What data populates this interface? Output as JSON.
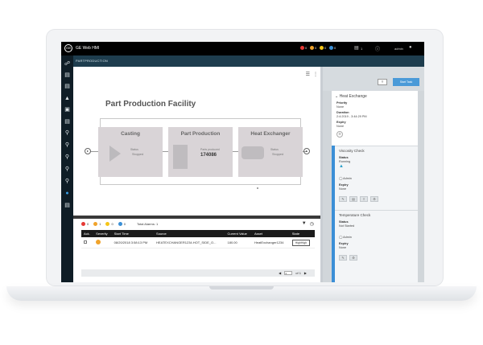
{
  "app": {
    "logo": "GE",
    "title": "GE Web HMI",
    "breadcrumb": "PARTPRODUCTION",
    "user": "admin",
    "alarm_counts": [
      {
        "count": "0",
        "color": "#e53935"
      },
      {
        "count": "0",
        "color": "#f0a32b"
      },
      {
        "count": "0",
        "color": "#f5c518"
      },
      {
        "count": "0",
        "color": "#3b8fd6"
      }
    ],
    "topbar_counter": "1"
  },
  "nav_icons": [
    "share-icon",
    "layers-icon",
    "layers-icon",
    "drop-icon",
    "image-icon",
    "layers-icon",
    "search-icon",
    "search-icon",
    "search-icon",
    "search-icon",
    "search-icon",
    "group-icon",
    "document-icon"
  ],
  "diagram": {
    "title": "Part Production Facility",
    "stages": [
      {
        "name": "Casting",
        "status_label": "Status",
        "status_value": "Stopped"
      },
      {
        "name": "Part Production",
        "parts_label": "Parts produced",
        "parts_value": "174086"
      },
      {
        "name": "Heat Exchanger",
        "status_label": "Status",
        "status_value": "Stopped"
      }
    ]
  },
  "alarms": {
    "severity_counts": [
      {
        "count": "0",
        "color": "#e53935"
      },
      {
        "count": "1",
        "color": "#f0a32b"
      },
      {
        "count": "0",
        "color": "#f5c518"
      },
      {
        "count": "0",
        "color": "#3b8fd6"
      }
    ],
    "total_label": "Total Alarms: 1",
    "columns": [
      "Ack.",
      "Severity",
      "Start Time",
      "Source",
      "Current Value",
      "Asset",
      "State"
    ],
    "rows": [
      {
        "start_time": "08/20/2018 3:58:13 PM",
        "source": "HEATEXCHANGER1234.HOT_SIDE_O...",
        "current_value": "180.00",
        "asset": "HeatExchanger1234",
        "state": "HighHigh"
      }
    ],
    "pager": {
      "page": "1",
      "of_label": "of 1"
    }
  },
  "task_panel": {
    "start_label": "Start Task",
    "heading": "Heat Exchange",
    "priority_label": "Priority",
    "priority_value": "None",
    "duration_label": "Duration",
    "duration_value": "2:4:2019 - 3:44:29 PM",
    "expiry_label": "Expiry",
    "expiry_value": "None",
    "steps": [
      {
        "title": "Viscosity Check",
        "status_label": "Status",
        "status_value": "Running",
        "assignee": "Admin",
        "expiry_label": "Expiry",
        "expiry_value": "None"
      },
      {
        "title": "Temperature Check",
        "status_label": "Status",
        "status_value": "Not Started",
        "assignee": "Admin",
        "expiry_label": "Expiry",
        "expiry_value": "None"
      }
    ]
  }
}
